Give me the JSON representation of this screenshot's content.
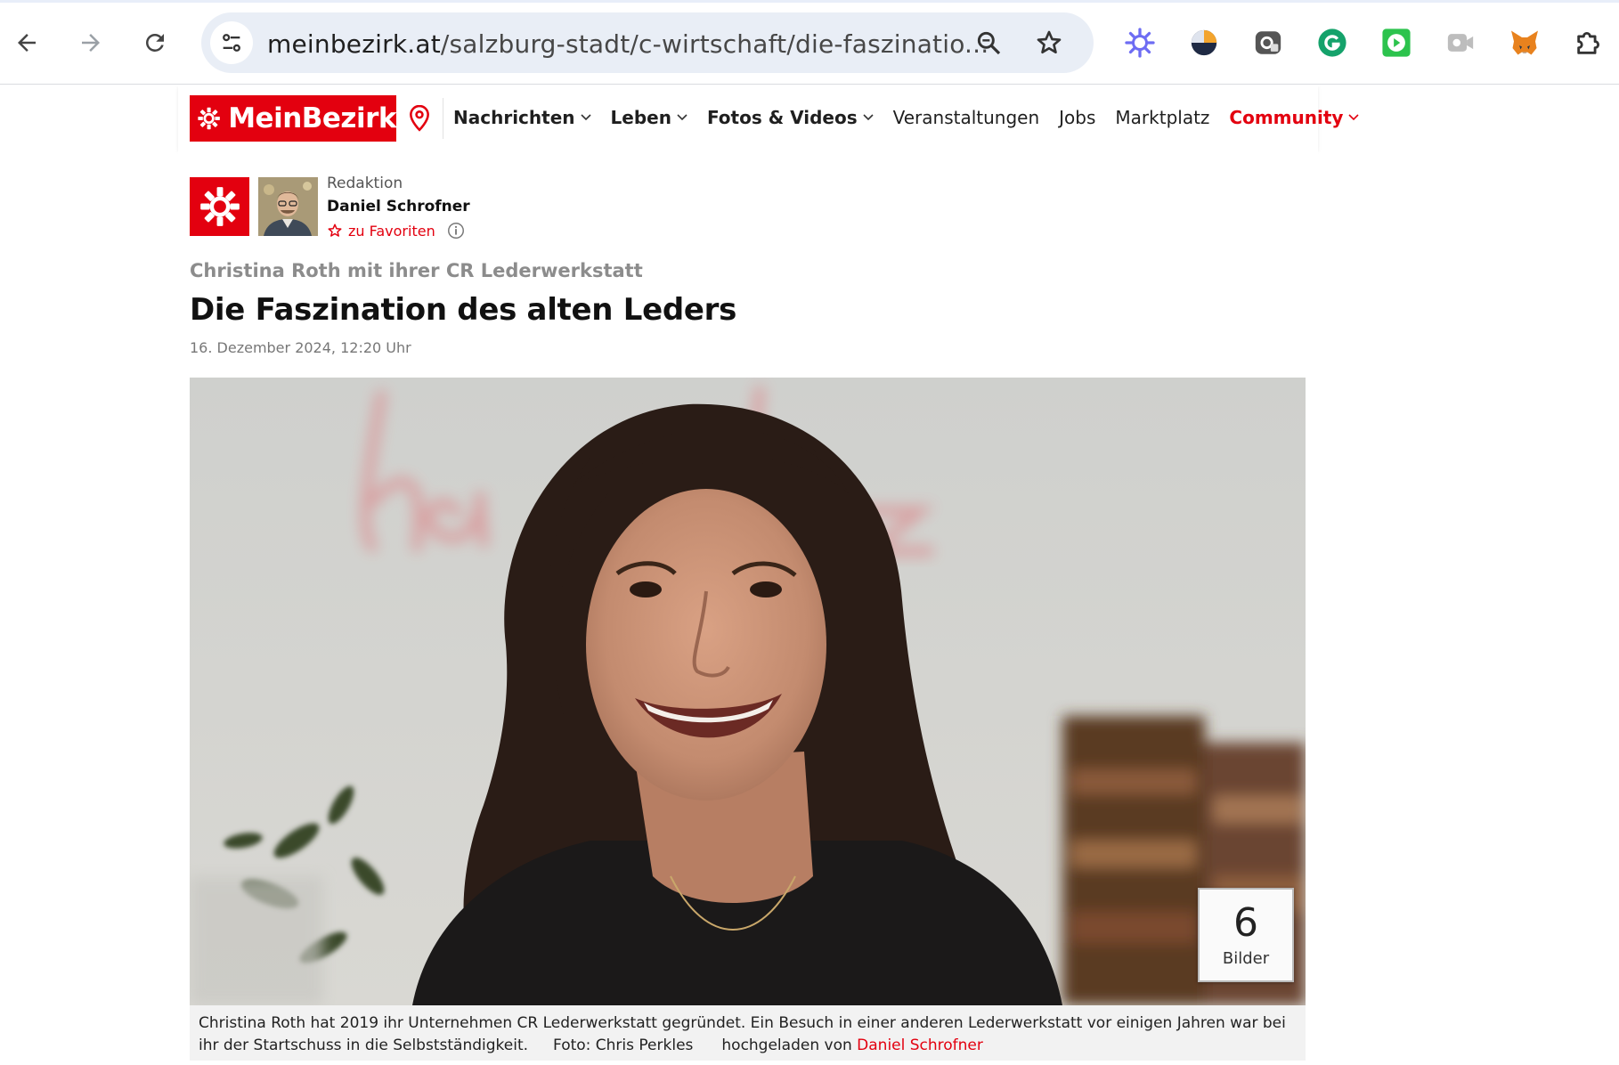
{
  "browser": {
    "url_domain": "meinbezirk.at",
    "url_path": "/salzburg-stadt/c-wirtschaft/die-faszinatio...",
    "extensions": [
      "perplexity-icon",
      "orb-icon",
      "screen-capture-icon",
      "grammarly-icon",
      "media-player-icon",
      "video-recorder-icon",
      "metamask-icon",
      "puzzle-extensions-icon"
    ]
  },
  "site": {
    "logo_text": "MeinBezirk",
    "brand_color": "#e3000f",
    "menu": [
      {
        "label": "Nachrichten"
      },
      {
        "label": "Leben"
      },
      {
        "label": "Fotos & Videos"
      },
      {
        "label": "Veranstaltungen"
      },
      {
        "label": "Jobs"
      },
      {
        "label": "Marktplatz"
      },
      {
        "label": "Community"
      }
    ]
  },
  "article": {
    "author_role": "Redaktion",
    "author_name": "Daniel Schrofner",
    "favorite_label": "zu Favoriten",
    "kicker": "Christina Roth mit ihrer CR Lederwerkstatt",
    "headline": "Die Faszination des alten Leders",
    "date": "16. Dezember 2024, 12:20 Uhr",
    "gallery_count": "6",
    "gallery_label": "Bilder",
    "caption_text": "Christina Roth hat 2019 ihr Unternehmen CR Lederwerkstatt gegründet. Ein Besuch in einer anderen Lederwerkstatt vor einigen Jahren war bei ihr der Startschuss in die Selbstständigkeit.",
    "photo_credit": "Foto: Chris Perkles",
    "uploaded_prefix": "hochgeladen von",
    "uploaded_by": "Daniel Schrofner"
  }
}
